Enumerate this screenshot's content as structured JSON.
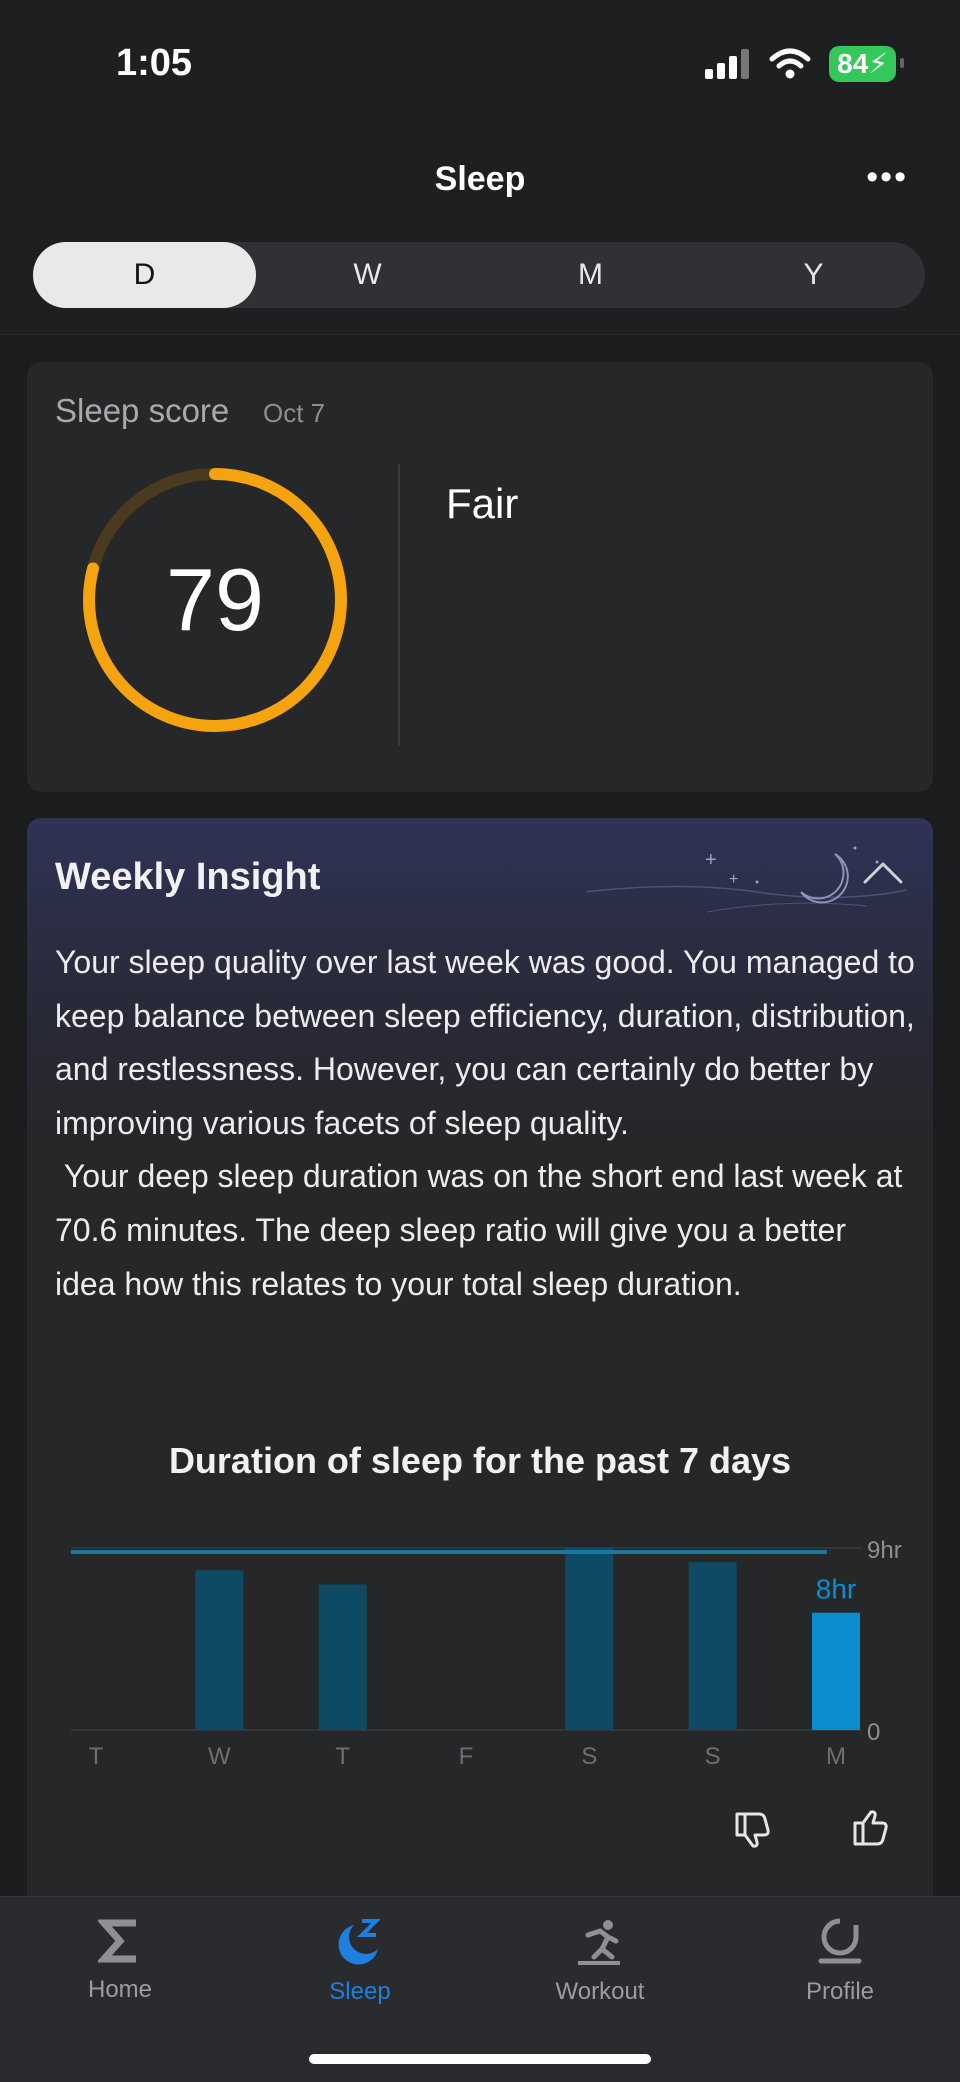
{
  "status": {
    "time": "1:05",
    "battery": "84"
  },
  "header": {
    "title": "Sleep",
    "more": "•••"
  },
  "tabs": [
    "D",
    "W",
    "M",
    "Y"
  ],
  "score": {
    "label": "Sleep score",
    "date": "Oct 7",
    "value": "79",
    "rating": "Fair",
    "progress": 0.79,
    "ring_color": "#f5a30f"
  },
  "insight": {
    "title": "Weekly Insight",
    "body": "Your sleep quality over last week was good. You managed to keep balance between sleep efficiency, duration, distribution, and restlessness. However, you can certainly do better by improving various facets of sleep quality.\n Your deep sleep duration was on the short end last week at 70.6 minutes. The deep sleep ratio will give you a better idea how this relates to your total sleep duration."
  },
  "chart_data": {
    "type": "bar",
    "title": "Duration of sleep for the past 7 days",
    "categories": [
      "T",
      "W",
      "T",
      "F",
      "S",
      "S",
      "M"
    ],
    "values": [
      0,
      7.9,
      7.2,
      0,
      9.0,
      8.3,
      5.8
    ],
    "ylim": [
      0,
      9
    ],
    "ytick_labels": [
      "0",
      "9hr"
    ],
    "reference_line": 8.8,
    "highlight_index": 6,
    "highlight_label": "8hr",
    "colors": {
      "bar": "#0e4a63",
      "highlight": "#0a8ed0",
      "line": "#16799d"
    }
  },
  "nav": [
    {
      "label": "Home",
      "icon": "home-sigma-icon",
      "active": false
    },
    {
      "label": "Sleep",
      "icon": "sleep-moon-icon",
      "active": true
    },
    {
      "label": "Workout",
      "icon": "workout-runner-icon",
      "active": false
    },
    {
      "label": "Profile",
      "icon": "profile-icon",
      "active": false
    }
  ]
}
